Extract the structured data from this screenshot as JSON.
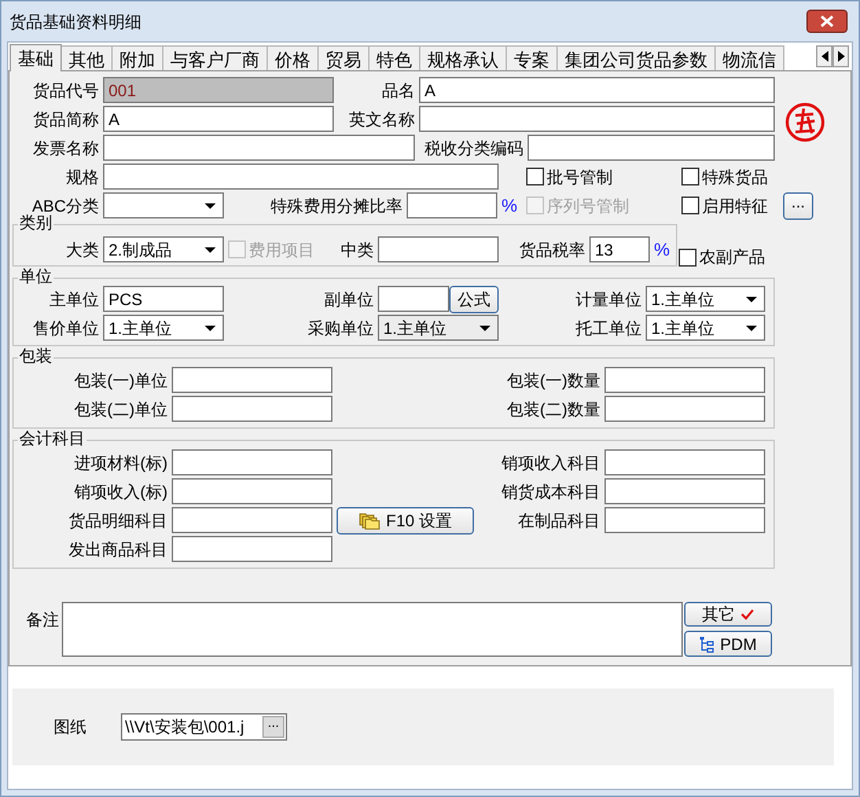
{
  "window": {
    "title": "货品基础资料明细"
  },
  "tabs": [
    {
      "label": "基础",
      "selected": true
    },
    {
      "label": "其他",
      "selected": false
    },
    {
      "label": "附加",
      "selected": false
    },
    {
      "label": "与客户厂商",
      "selected": false
    },
    {
      "label": "价格",
      "selected": false
    },
    {
      "label": "贸易",
      "selected": false
    },
    {
      "label": "特色",
      "selected": false
    },
    {
      "label": "规格承认",
      "selected": false
    },
    {
      "label": "专案",
      "selected": false
    },
    {
      "label": "集团公司货品参数",
      "selected": false
    },
    {
      "label": "物流信",
      "selected": false
    }
  ],
  "basic": {
    "goods_code": {
      "label": "货品代号",
      "value": "001",
      "disabled": true
    },
    "name": {
      "label": "品名",
      "value": "A"
    },
    "short_name": {
      "label": "货品简称",
      "value": "A"
    },
    "english_name": {
      "label": "英文名称"
    },
    "invoice_name": {
      "label": "发票名称"
    },
    "tax_class_code": {
      "label": "税收分类编码"
    },
    "spec": {
      "label": "规格"
    },
    "abc_class": {
      "label": "ABC分类"
    },
    "cost_share_rate": {
      "label": "特殊费用分摊比率",
      "unit": "%"
    },
    "batch_control": {
      "label": "批号管制",
      "checked": false,
      "disabled": false
    },
    "serial_control": {
      "label": "序列号管制",
      "checked": false,
      "disabled": true
    },
    "special_goods": {
      "label": "特殊货品",
      "checked": false,
      "disabled": false
    },
    "enable_feature": {
      "label": "启用特征",
      "checked": false,
      "disabled": false
    },
    "feature_button": "..."
  },
  "category": {
    "title": "类别",
    "major": {
      "label": "大类",
      "value": "2.制成品"
    },
    "expense_item": {
      "label": "费用项目",
      "checked": false,
      "disabled": true
    },
    "middle": {
      "label": "中类"
    },
    "tax_rate": {
      "label": "货品税率",
      "value": "13",
      "unit": "%"
    },
    "agricultural": {
      "label": "农副产品",
      "checked": false,
      "disabled": false
    }
  },
  "units": {
    "title": "单位",
    "main": {
      "label": "主单位",
      "value": "PCS"
    },
    "sub": {
      "label": "副单位"
    },
    "formula_button": "公式",
    "measure": {
      "label": "计量单位",
      "value": "1.主单位"
    },
    "sale": {
      "label": "售价单位",
      "value": "1.主单位"
    },
    "purchase": {
      "label": "采购单位",
      "value": "1.主单位",
      "disabled": true
    },
    "outsourcing": {
      "label": "托工单位",
      "value": "1.主单位"
    }
  },
  "packaging": {
    "title": "包装",
    "unit1": {
      "label": "包装(一)单位"
    },
    "qty1": {
      "label": "包装(一)数量"
    },
    "unit2": {
      "label": "包装(二)单位"
    },
    "qty2": {
      "label": "包装(二)数量"
    }
  },
  "accounting": {
    "title": "会计科目",
    "left": [
      {
        "label": "进项材料(标)"
      },
      {
        "label": "销项收入(标)"
      },
      {
        "label": "货品明细科目"
      },
      {
        "label": "发出商品科目"
      }
    ],
    "right": [
      {
        "label": "销项收入科目"
      },
      {
        "label": "销货成本科目"
      },
      {
        "label": "在制品科目"
      }
    ],
    "setup_button": "F10 设置"
  },
  "remarks": {
    "label": "备注",
    "other_button": "其它",
    "pdm_button": "PDM"
  },
  "drawing": {
    "label": "图纸",
    "value": "\\\\Vt\\安装包\\001.j",
    "button": "..."
  }
}
